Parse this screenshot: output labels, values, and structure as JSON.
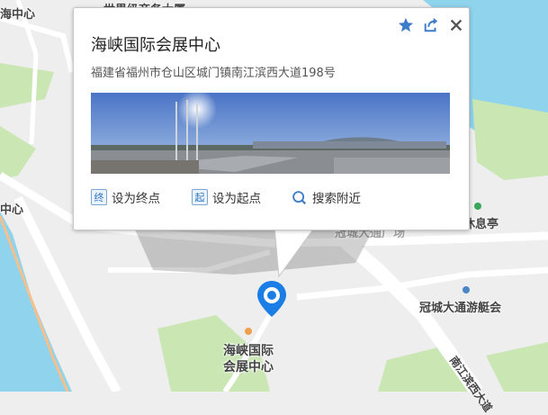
{
  "popup": {
    "title": "海峡国际会展中心",
    "address": "福建省福州市仓山区城门镇南江滨西大道198号",
    "actions": {
      "set_end": {
        "badge": "终",
        "label": "设为终点"
      },
      "set_start": {
        "badge": "起",
        "label": "设为起点"
      },
      "search_nearby": {
        "label": "搜索附近"
      }
    },
    "icons": {
      "favorite": "star-icon",
      "share": "share-icon",
      "close": "close-icon"
    }
  },
  "map": {
    "labels": {
      "top_left": "海中心",
      "top_center_partial": "世界级商务大厦",
      "left_mid": "中心",
      "rest_pavilion": "休息亭",
      "road_partial": "冠城大通广场",
      "marina": "冠城大通游艇会",
      "selected_poi_line1": "海峡国际",
      "selected_poi_line2": "会展中心",
      "road_bottom_right": "南江滨西大道"
    },
    "colors": {
      "water": "#8fd3ec",
      "land": "#eeeeee",
      "green": "#c9e6b3",
      "road": "#ffffff",
      "pin": "#1b7de6",
      "accent_link": "#2f73c0"
    }
  }
}
